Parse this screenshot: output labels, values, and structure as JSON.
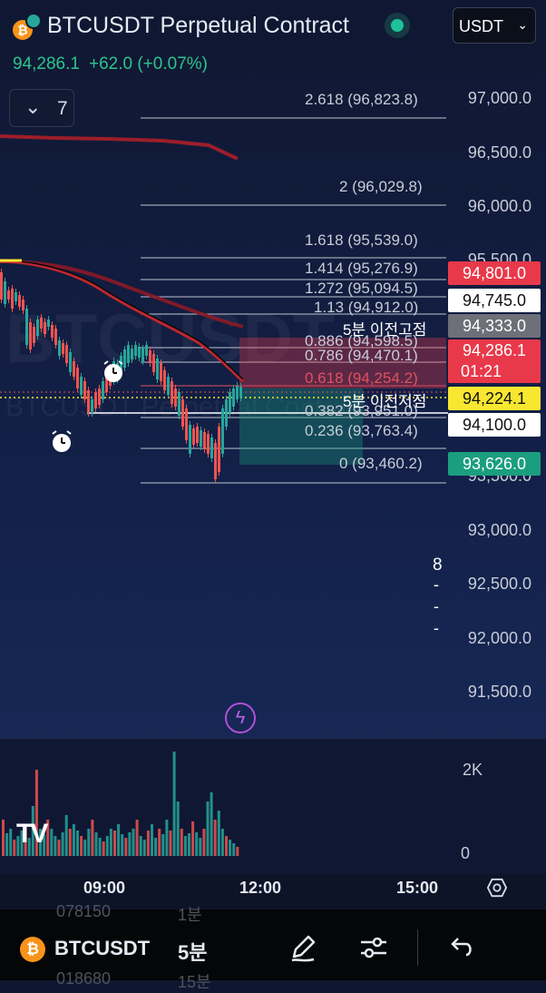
{
  "header": {
    "title": "BTCUSDT Perpetual Contract",
    "coin_glyph": "₿",
    "currency": "USDT",
    "last_price": "94,286.1",
    "change": "+62.0 (+0.07%)"
  },
  "indicators_button": {
    "count": "7"
  },
  "price_axis": [
    "97,000.0",
    "96,500.0",
    "96,000.0",
    "95,500.0",
    "93,500.0",
    "93,000.0",
    "92,500.0",
    "92,000.0",
    "91,500.0"
  ],
  "fib_levels": [
    "2.618 (96,823.8)",
    "2 (96,029.8)",
    "1.618 (95,539.0)",
    "1.414 (95,276.9)",
    "1.272 (95,094.5)",
    "1.13 (94,912.0)",
    "0.886 (94,598.5)",
    "0.786 (94,470.1)",
    "0.618 (94,254.2)",
    "0.382 (93,951.0)",
    "0.236 (93,763.4)",
    "0 (93,460.2)"
  ],
  "notes": {
    "prev_high": "5분 이전고점",
    "prev_low": "5분 이전저점"
  },
  "price_tags": {
    "t1": "94,801.0",
    "t2": "94,745.0",
    "t3": "94,333.0",
    "t4": "94,286.1",
    "countdown": "01:21",
    "t5": "94,224.1",
    "t6": "94,100.0",
    "t7": "93,626.0"
  },
  "scale_marker": "8",
  "volume_axis": {
    "top": "2K",
    "bottom": "0"
  },
  "time_axis": [
    "09:00",
    "12:00",
    "15:00"
  ],
  "watermark": "BTCUSDT",
  "watermark_sub": "BTCUSDT Perpetual Contract",
  "bottom_bar": {
    "symbol": "BTCUSDT",
    "interval": "5분",
    "ghost_top_left": "078150",
    "ghost_top_right": "1분",
    "ghost_bottom_left": "018680",
    "ghost_bottom_right": "15분"
  },
  "colors": {
    "up": "#26a69a",
    "down": "#ef5350",
    "accent": "#1fc29a",
    "price_text": "#2fc48d"
  },
  "icons": [
    "live-dot-icon",
    "chevron-down-icon",
    "lightning-icon",
    "settings-hexagon-icon",
    "pen-icon",
    "sliders-icon",
    "undo-icon",
    "alarm-icon"
  ]
}
